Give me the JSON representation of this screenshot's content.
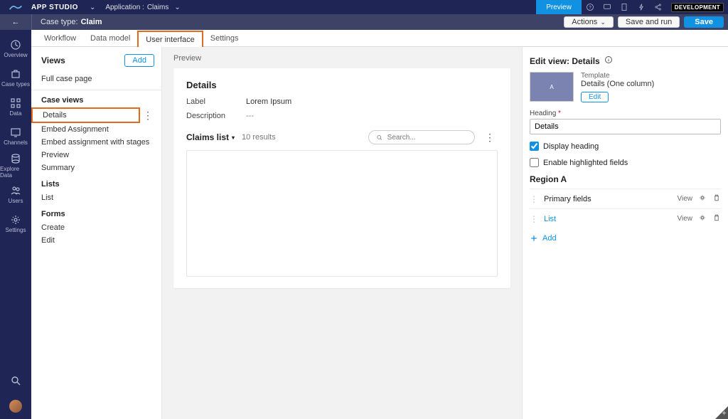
{
  "topbar": {
    "app_title": "APP STUDIO",
    "app_label": "Application :",
    "app_name": "Claims",
    "preview_btn": "Preview",
    "env_tag": "DEVELOPMENT"
  },
  "subhead": {
    "crumb_label": "Case type:",
    "crumb_value": "Claim",
    "actions_btn": "Actions",
    "save_run_btn": "Save and run",
    "save_btn": "Save"
  },
  "rail": {
    "items": [
      {
        "label": "Overview"
      },
      {
        "label": "Case types"
      },
      {
        "label": "Data"
      },
      {
        "label": "Channels"
      },
      {
        "label": "Explore Data"
      },
      {
        "label": "Users"
      },
      {
        "label": "Settings"
      }
    ]
  },
  "tabs": [
    {
      "label": "Workflow"
    },
    {
      "label": "Data model"
    },
    {
      "label": "User interface"
    },
    {
      "label": "Settings"
    }
  ],
  "views_panel": {
    "title": "Views",
    "add_btn": "Add",
    "full_case": "Full case page",
    "sections": {
      "case_views": {
        "title": "Case views",
        "items": [
          "Details",
          "Embed Assignment",
          "Embed assignment with stages",
          "Preview",
          "Summary"
        ],
        "selected": "Details"
      },
      "lists": {
        "title": "Lists",
        "items": [
          "List"
        ]
      },
      "forms": {
        "title": "Forms",
        "items": [
          "Create",
          "Edit"
        ]
      }
    }
  },
  "preview": {
    "label": "Preview",
    "heading": "Details",
    "kv": {
      "label_k": "Label",
      "label_v": "Lorem Ipsum",
      "desc_k": "Description",
      "desc_v": "---"
    },
    "list": {
      "title": "Claims list",
      "count": "10 results",
      "search_placeholder": "Search..."
    }
  },
  "edit": {
    "title": "Edit view: Details",
    "template_lbl": "Template",
    "template_name": "Details (One column)",
    "template_thumb": "A",
    "edit_btn": "Edit",
    "heading_lbl": "Heading",
    "heading_val": "Details",
    "display_heading": "Display heading",
    "enable_highlighted": "Enable highlighted fields",
    "region_a": "Region A",
    "rows": [
      {
        "name": "Primary fields",
        "link": false,
        "right": "View"
      },
      {
        "name": "List",
        "link": true,
        "right": "View"
      }
    ],
    "add": "Add"
  }
}
